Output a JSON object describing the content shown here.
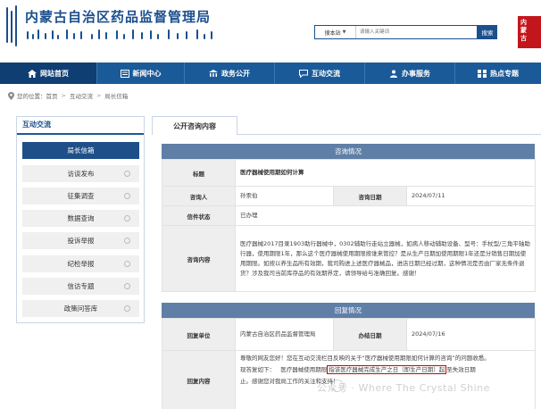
{
  "header": {
    "site_title": "内蒙古自治区药品监督管理局",
    "search_scope": "搜本站",
    "search_placeholder": "请输入关键词",
    "search_button": "搜索",
    "seal_text": "内蒙古"
  },
  "nav": {
    "items": [
      {
        "label": "网站首页",
        "icon": "home-icon",
        "active": true
      },
      {
        "label": "新闻中心",
        "icon": "news-icon"
      },
      {
        "label": "政务公开",
        "icon": "building-icon"
      },
      {
        "label": "互动交流",
        "icon": "chat-icon"
      },
      {
        "label": "办事服务",
        "icon": "user-icon"
      },
      {
        "label": "热点专题",
        "icon": "grid-icon"
      }
    ]
  },
  "breadcrumb": {
    "prefix": "您的位置：",
    "items": [
      "首页",
      "互动交流",
      "局长信箱"
    ]
  },
  "sidebar": {
    "title": "互动交流",
    "items": [
      {
        "label": "局长信箱",
        "active": true
      },
      {
        "label": "访谈发布"
      },
      {
        "label": "征集调查"
      },
      {
        "label": "数据查询"
      },
      {
        "label": "投诉举报"
      },
      {
        "label": "纪检举报"
      },
      {
        "label": "信访专题"
      },
      {
        "label": "政策问答库"
      }
    ]
  },
  "main": {
    "tab_label": "公开咨询内容",
    "consult": {
      "head": "咨询情况",
      "title_label": "标题",
      "title_value": "医疗器械使用期如何计算",
      "person_label": "咨询人",
      "person_value": "孙汞伯",
      "date_label": "咨询日期",
      "date_value": "2024/07/11",
      "status_label": "信件状态",
      "status_value": "已办理",
      "content_label": "咨询内容",
      "content_value": "医疗器械2017目录1903助行器械中，0302辅助行走站立器械，如病人移动辅助设备、型号：手杖型/三角平轴助行器，使用期限1年，那么这个医疗器械使用期限按谁来管控？是从生产日期加使用期限1年还是分销售日期加使用期限。如按以养生品所有效期，我司购进上述医疗器械品，进店日期已经过期，这种情况是否由厂家无条件退货？涉及我司当前库存品的有效期界定，请领导给与准确回复。感谢！"
    },
    "reply": {
      "head": "回复情况",
      "unit_label": "回复单位",
      "unit_value": "内蒙古自治区药品监督管理局",
      "date_label": "办结日期",
      "date_value": "2024/07/16",
      "content_label": "回复内容",
      "line1": "尊敬的网友您好！您在互动交流栏目反映的关于“医疗器械使用期限如何计算的咨询”的问题收悉。",
      "line2_a": "现答复如下：",
      "line2_b": "医疗器械使用期限",
      "line2_hl": "指该医疗器械完成生产之日（即生产日期）起",
      "line2_c": "至失效日期",
      "line3": "止。感谢您对我局工作的关注和支持！",
      "line4": "感谢您对我局"
    }
  },
  "watermark": "公众号 · Where The Crystal Shine"
}
